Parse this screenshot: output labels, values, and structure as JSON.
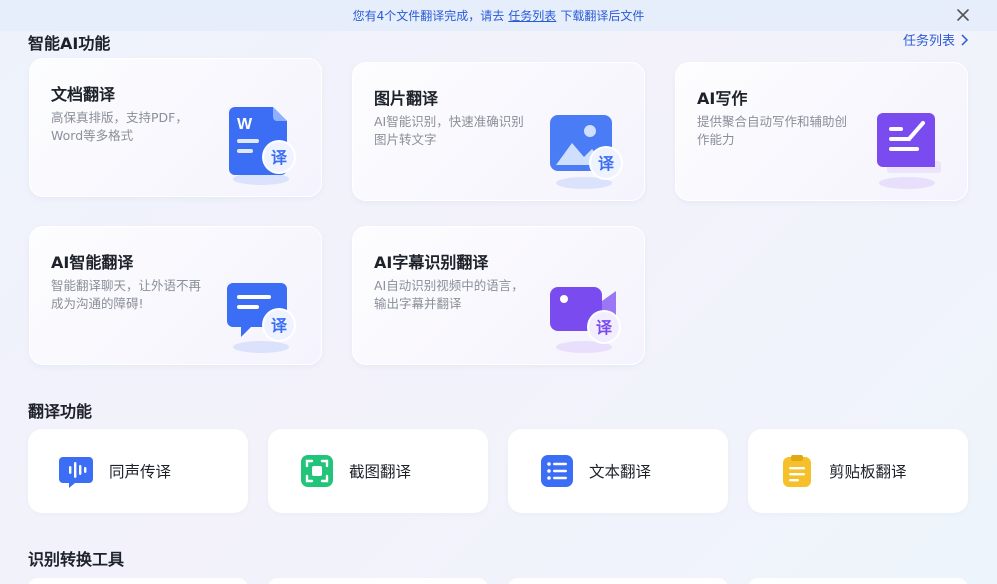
{
  "banner": {
    "before": "您有4个文件翻译完成，请去",
    "link": "任务列表",
    "after": "下载翻译后文件"
  },
  "sections": {
    "ai": "智能AI功能",
    "translate": "翻译功能",
    "tools": "识别转换工具"
  },
  "task_link": "任务列表",
  "cards": [
    {
      "title": "文档翻译",
      "desc": "高保真排版，支持PDF，Word等多格式"
    },
    {
      "title": "图片翻译",
      "desc": "AI智能识别，快速准确识别图片转文字"
    },
    {
      "title": "AI写作",
      "desc": "提供聚合自动写作和辅助创作能力"
    },
    {
      "title": "AI智能翻译",
      "desc": "智能翻译聊天，让外语不再成为沟通的障碍!"
    },
    {
      "title": "AI字幕识别翻译",
      "desc": "AI自动识别视频中的语言，输出字幕并翻译"
    }
  ],
  "badge_text": "译",
  "doc_letter": "W",
  "tiles": [
    {
      "label": "同声传译"
    },
    {
      "label": "截图翻译"
    },
    {
      "label": "文本翻译"
    },
    {
      "label": "剪贴板翻译"
    }
  ],
  "colors": {
    "accent": "#2a5bd7",
    "banner_bg": "#e6eefb",
    "blue": "#3b6ef5",
    "purple": "#7a4cf0",
    "green": "#22c47a",
    "yellow": "#f5c02a"
  }
}
